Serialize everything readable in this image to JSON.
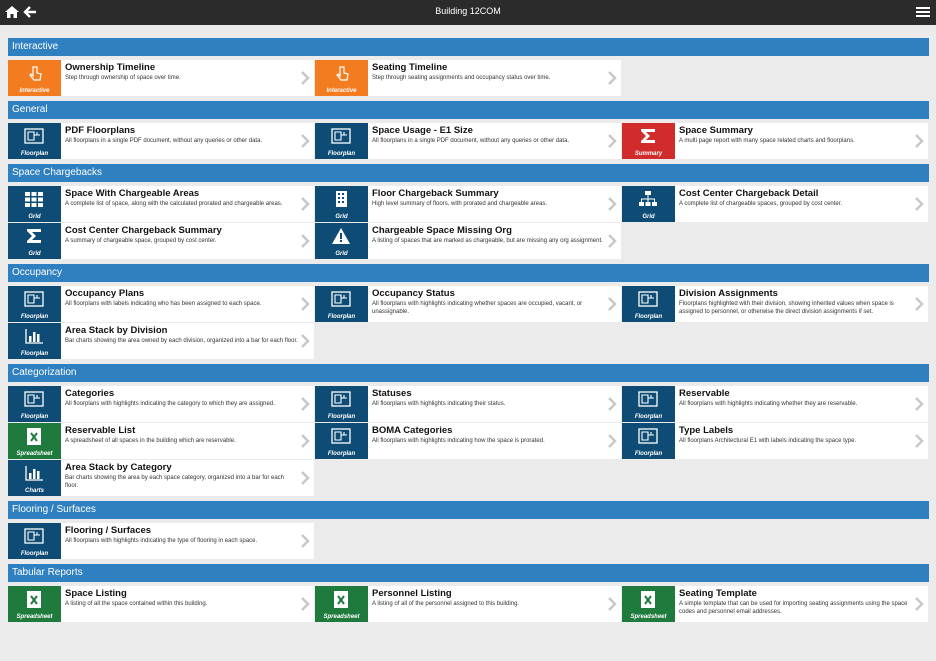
{
  "header": {
    "title": "Building 12COM"
  },
  "sections": [
    {
      "title": "Interactive",
      "cards": [
        {
          "name": "Ownership Timeline",
          "desc": "Step through ownership of space over time.",
          "type": "Interactive",
          "icon": "pointer-hand-icon"
        },
        {
          "name": "Seating Timeline",
          "desc": "Step through seating assignments and occupancy status over time.",
          "type": "Interactive",
          "icon": "pointer-hand-icon"
        }
      ]
    },
    {
      "title": "General",
      "cards": [
        {
          "name": "PDF Floorplans",
          "desc": "All floorplans in a single PDF document, without any queries or other data.",
          "type": "Floorplan",
          "icon": "floorplan-icon"
        },
        {
          "name": "Space Usage - E1 Size",
          "desc": "All floorplans in a single PDF document, without any queries or other data.",
          "type": "Floorplan",
          "icon": "floorplan-icon"
        },
        {
          "name": "Space Summary",
          "desc": "A multi page report with many space related charts and floorplans.",
          "type": "Summary",
          "icon": "sigma-icon"
        }
      ]
    },
    {
      "title": "Space Chargebacks",
      "cards": [
        {
          "name": "Space With Chargeable Areas",
          "desc": "A complete list of space, along with the calculated prorated and chargeable areas.",
          "type": "Grid",
          "icon": "grid-icon"
        },
        {
          "name": "Floor Chargeback Summary",
          "desc": "High level summary of floors, with prorated and chargeable areas.",
          "type": "Grid",
          "icon": "building-icon"
        },
        {
          "name": "Cost Center Chargeback Detail",
          "desc": "A complete list of chargeable spaces, grouped by cost center.",
          "type": "Grid",
          "icon": "org-chart-icon"
        },
        {
          "name": "Cost Center Chargeback Summary",
          "desc": "A summary of chargeable space, grouped by cost center.",
          "type": "Grid",
          "icon": "sigma-icon"
        },
        {
          "name": "Chargeable Space Missing Org",
          "desc": "A listing of spaces that are marked as chargeable, but are missing any org assignment.",
          "type": "Grid",
          "icon": "warning-icon"
        }
      ]
    },
    {
      "title": "Occupancy",
      "cards": [
        {
          "name": "Occupancy Plans",
          "desc": "All floorplans with labels indicating who has been assigned to each space.",
          "type": "Floorplan",
          "icon": "floorplan-icon"
        },
        {
          "name": "Occupancy Status",
          "desc": "All floorplans with highlights indicating whether spaces are occupied, vacant, or unassignable.",
          "type": "Floorplan",
          "icon": "floorplan-icon"
        },
        {
          "name": "Division Assignments",
          "desc": "Floorplans highlighted with their division, showing inherited values when space is assigned to personnel, or otherwise the direct division assignments if set.",
          "type": "Floorplan",
          "icon": "floorplan-icon"
        },
        {
          "name": "Area Stack by Division",
          "desc": "Bar charts showing the area owned by each division, organized into a bar for each floor.",
          "type": "Floorplan",
          "icon": "bar-chart-icon"
        }
      ]
    },
    {
      "title": "Categorization",
      "cards": [
        {
          "name": "Categories",
          "desc": "All floorplans with highlights indicating the category to which they are assigned.",
          "type": "Floorplan",
          "icon": "floorplan-icon"
        },
        {
          "name": "Statuses",
          "desc": "All floorplans with highlights indicating their status.",
          "type": "Floorplan",
          "icon": "floorplan-icon"
        },
        {
          "name": "Reservable",
          "desc": "All floorplans with highlights indicating whether they are reservable.",
          "type": "Floorplan",
          "icon": "floorplan-icon"
        },
        {
          "name": "Reservable List",
          "desc": "A spreadsheet of all spaces in the building which are reservable.",
          "type": "Spreadsheet",
          "icon": "excel-icon"
        },
        {
          "name": "BOMA Categories",
          "desc": "All floorplans with highlights indicating how the space is prorated.",
          "type": "Floorplan",
          "icon": "floorplan-icon"
        },
        {
          "name": "Type Labels",
          "desc": "All floorplans Architectural E1 with labels indicating the space type.",
          "type": "Floorplan",
          "icon": "floorplan-icon"
        },
        {
          "name": "Area Stack by Category",
          "desc": "Bar charts showing the area by each space category, organized into a bar for each floor.",
          "type": "Charts",
          "icon": "bar-chart-icon"
        }
      ]
    },
    {
      "title": "Flooring / Surfaces",
      "cards": [
        {
          "name": "Flooring / Surfaces",
          "desc": "All floorplans with highlights indicating the type of flooring in each space.",
          "type": "Floorplan",
          "icon": "floorplan-icon"
        }
      ]
    },
    {
      "title": "Tabular Reports",
      "cards": [
        {
          "name": "Space Listing",
          "desc": "A listing of all the space contained within this building.",
          "type": "Spreadsheet",
          "icon": "excel-icon"
        },
        {
          "name": "Personnel Listing",
          "desc": "A listing of all of the personnel assigned to this building.",
          "type": "Spreadsheet",
          "icon": "excel-icon"
        },
        {
          "name": "Seating Template",
          "desc": "A simple template that can be used for importing seating assignments using the space codes and personnel email addresses.",
          "type": "Spreadsheet",
          "icon": "excel-icon"
        }
      ]
    }
  ]
}
